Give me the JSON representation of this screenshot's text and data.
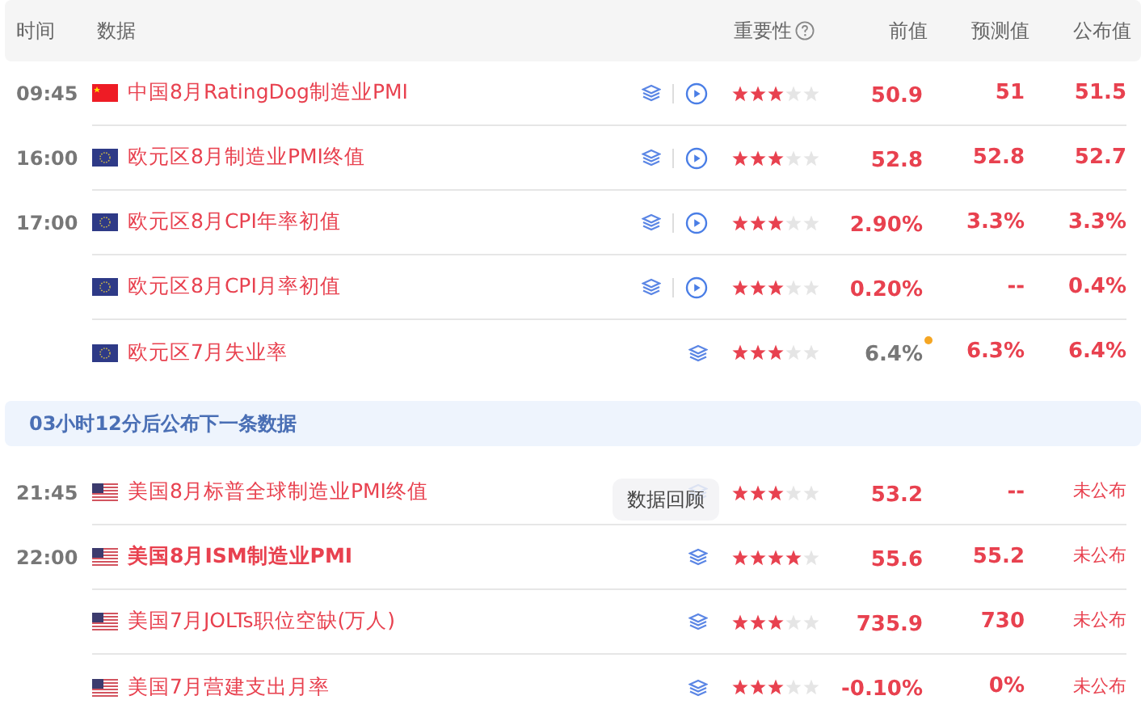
{
  "columns": {
    "time": "时间",
    "data": "数据",
    "importance": "重要性",
    "previous": "前值",
    "forecast": "预测值",
    "actual": "公布值"
  },
  "rows_before": [
    {
      "time": "09:45",
      "kind": "cn",
      "name": "中国8月RatingDog制造业PMI",
      "bold": false,
      "video": true,
      "stars": 3,
      "previous": "50.9",
      "revised": false,
      "forecast": "51",
      "actual": "51.5",
      "published": true
    },
    {
      "time": "16:00",
      "kind": "eu",
      "name": "欧元区8月制造业PMI终值",
      "bold": false,
      "video": true,
      "stars": 3,
      "previous": "52.8",
      "revised": false,
      "forecast": "52.8",
      "actual": "52.7",
      "published": true
    },
    {
      "time": "17:00",
      "kind": "eu",
      "name": "欧元区8月CPI年率初值",
      "bold": false,
      "video": true,
      "stars": 3,
      "previous": "2.90%",
      "revised": false,
      "forecast": "3.3%",
      "actual": "3.3%",
      "published": true
    },
    {
      "kind": "eu",
      "name": "欧元区8月CPI月率初值",
      "bold": false,
      "video": true,
      "stars": 3,
      "previous": "0.20%",
      "revised": false,
      "forecast": "--",
      "actual": "0.4%",
      "published": true
    },
    {
      "kind": "eu",
      "name": "欧元区7月失业率",
      "bold": false,
      "video": false,
      "stars": 3,
      "previous": "6.4%",
      "revised": true,
      "forecast": "6.3%",
      "actual": "6.4%",
      "published": true
    }
  ],
  "countdown": "03小时12分后公布下一条数据",
  "rows_after": [
    {
      "time": "21:45",
      "kind": "us",
      "name": "美国8月标普全球制造业PMI终值",
      "bold": false,
      "stars": 3,
      "previous": "53.2",
      "revised": false,
      "forecast": "--",
      "actual": "未公布",
      "published": false,
      "tooltip": "数据回顾"
    },
    {
      "time": "22:00",
      "kind": "us",
      "name": "美国8月ISM制造业PMI",
      "bold": true,
      "video": false,
      "stars": 4,
      "previous": "55.6",
      "revised": false,
      "forecast": "55.2",
      "actual": "未公布",
      "published": false
    },
    {
      "kind": "us",
      "name": "美国7月JOLTs职位空缺(万人)",
      "bold": false,
      "video": false,
      "stars": 3,
      "previous": "735.9",
      "revised": false,
      "forecast": "730",
      "actual": "未公布",
      "published": false
    },
    {
      "kind": "us",
      "name": "美国7月营建支出月率",
      "bold": false,
      "video": false,
      "stars": 3,
      "previous": "-0.10%",
      "revised": false,
      "forecast": "0%",
      "actual": "未公布",
      "published": false
    }
  ]
}
